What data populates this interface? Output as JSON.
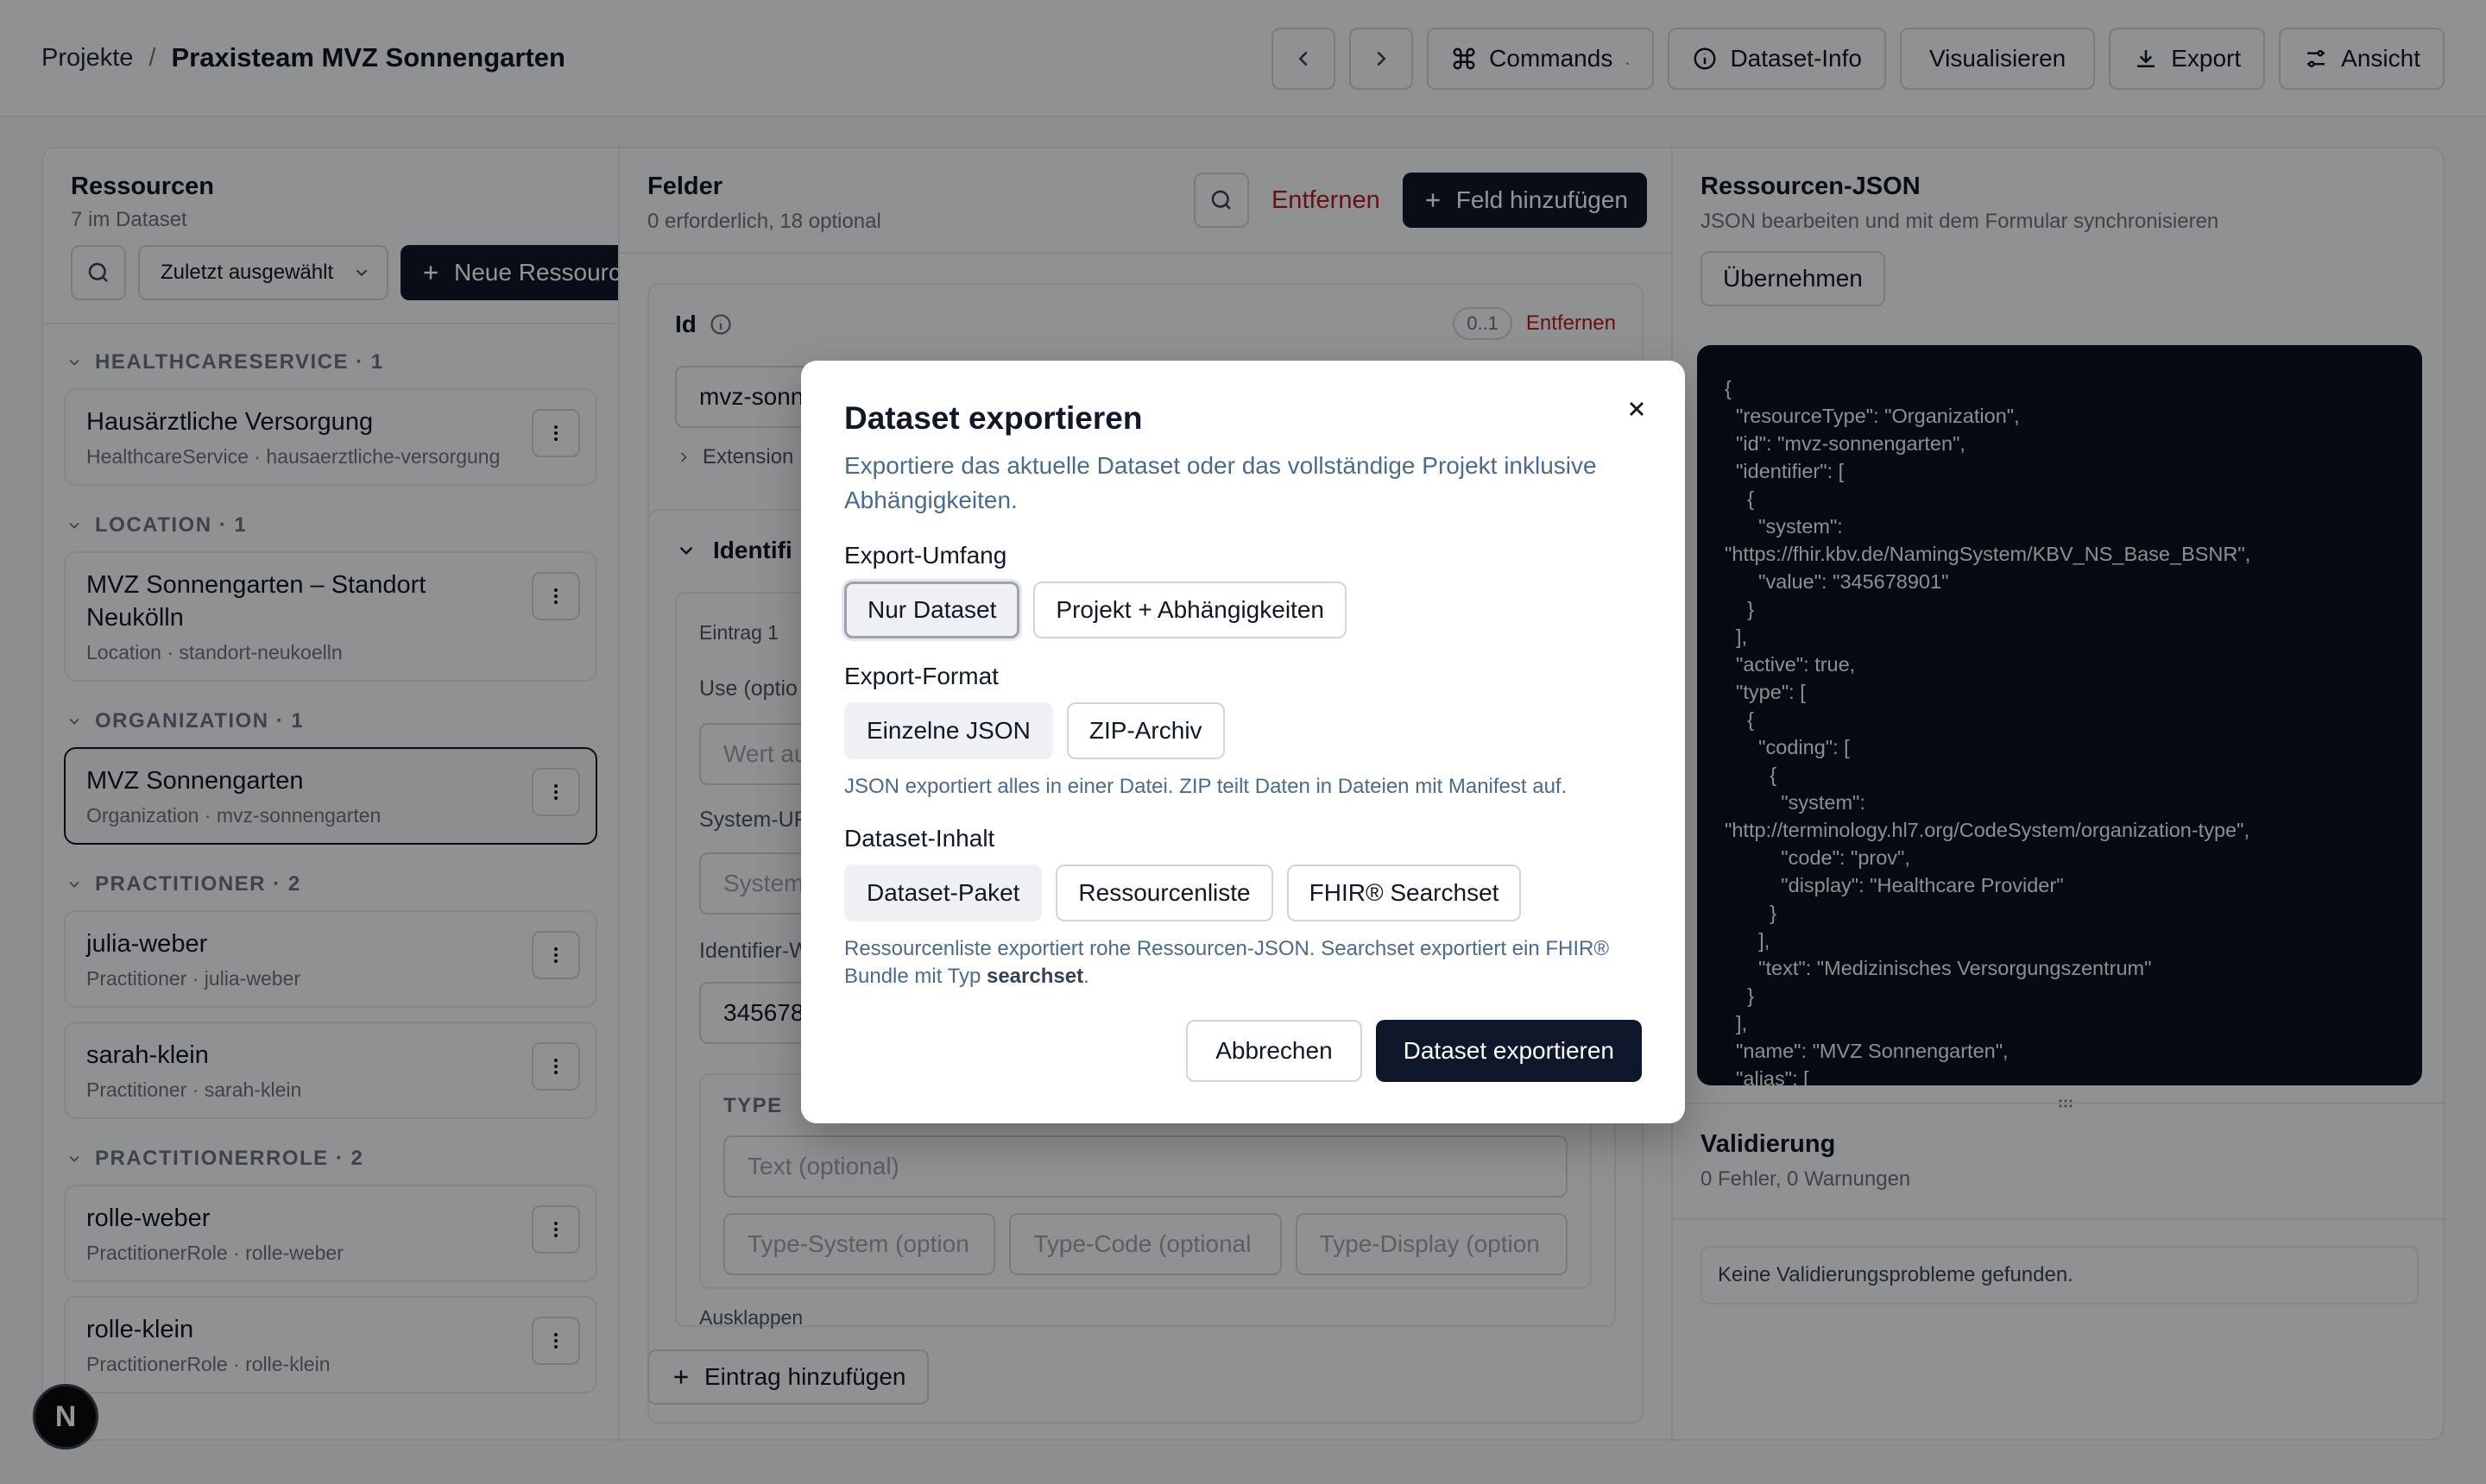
{
  "header": {
    "breadcrumb_root": "Projekte",
    "breadcrumb_sep": "/",
    "breadcrumb_current": "Praxisteam MVZ Sonnengarten",
    "buttons": {
      "commands": "Commands",
      "commands_shortcut": ".",
      "dataset_info": "Dataset-Info",
      "visualize": "Visualisieren",
      "export": "Export",
      "view": "Ansicht"
    }
  },
  "left": {
    "title": "Ressourcen",
    "subtitle": "7 im Dataset",
    "sort_select": "Zuletzt ausgewählt",
    "new_button": "Neue Ressource",
    "groups": [
      {
        "label": "HEALTHCARESERVICE · 1",
        "items": [
          {
            "title": "Hausärztliche Versorgung",
            "sub": "HealthcareService · hausaerztliche-versorgung"
          }
        ]
      },
      {
        "label": "LOCATION · 1",
        "items": [
          {
            "title": "MVZ Sonnengarten – Standort Neukölln",
            "sub": "Location · standort-neukoelln"
          }
        ]
      },
      {
        "label": "ORGANIZATION · 1",
        "items": [
          {
            "title": "MVZ Sonnengarten",
            "sub": "Organization · mvz-sonnengarten"
          }
        ]
      },
      {
        "label": "PRACTITIONER · 2",
        "items": [
          {
            "title": "julia-weber",
            "sub": "Practitioner · julia-weber"
          },
          {
            "title": "sarah-klein",
            "sub": "Practitioner · sarah-klein"
          }
        ]
      },
      {
        "label": "PRACTITIONERROLE · 2",
        "items": [
          {
            "title": "rolle-weber",
            "sub": "PractitionerRole · rolle-weber"
          },
          {
            "title": "rolle-klein",
            "sub": "PractitionerRole · rolle-klein"
          }
        ]
      }
    ]
  },
  "mid": {
    "title": "Felder",
    "subtitle": "0 erforderlich, 18 optional",
    "remove": "Entfernen",
    "add_field": "Feld hinzufügen",
    "id_label": "Id",
    "id_card_label": "0..1",
    "id_remove": "Entfernen",
    "id_value": "mvz-sonn",
    "extension": "Extension",
    "identifier_label": "Identifi",
    "entry_label": "Eintrag 1",
    "use_label": "Use (optio",
    "value_placeholder": "Wert au",
    "system_label": "System-UR",
    "system_placeholder": "System",
    "identifier_value_label": "Identifier-W",
    "identifier_value": "345678",
    "type_label": "TYPE",
    "text_placeholder": "Text (optional)",
    "type_system": "Type-System (option",
    "type_code": "Type-Code (optional",
    "type_display": "Type-Display (option",
    "collapse": "Ausklappen",
    "add_entry": "Eintrag hinzufügen"
  },
  "right": {
    "title": "Ressourcen-JSON",
    "subtitle": "JSON bearbeiten und mit dem Formular synchronisieren",
    "apply": "Übernehmen",
    "json_text": "{\n  \"resourceType\": \"Organization\",\n  \"id\": \"mvz-sonnengarten\",\n  \"identifier\": [\n    {\n      \"system\":\n\"https://fhir.kbv.de/NamingSystem/KBV_NS_Base_BSNR\",\n      \"value\": \"345678901\"\n    }\n  ],\n  \"active\": true,\n  \"type\": [\n    {\n      \"coding\": [\n        {\n          \"system\":\n\"http://terminology.hl7.org/CodeSystem/organization-type\",\n          \"code\": \"prov\",\n          \"display\": \"Healthcare Provider\"\n        }\n      ],\n      \"text\": \"Medizinisches Versorgungszentrum\"\n    }\n  ],\n  \"name\": \"MVZ Sonnengarten\",\n  \"alias\": [",
    "validation_title": "Validierung",
    "validation_sub": "0 Fehler, 0 Warnungen",
    "validation_msg": "Keine Validierungsprobleme gefunden."
  },
  "modal": {
    "title": "Dataset exportieren",
    "description": "Exportiere das aktuelle Dataset oder das vollständige Projekt inklusive Abhängigkeiten.",
    "scope_label": "Export-Umfang",
    "scope_options": [
      "Nur Dataset",
      "Projekt + Abhängigkeiten"
    ],
    "format_label": "Export-Format",
    "format_options": [
      "Einzelne JSON",
      "ZIP-Archiv"
    ],
    "format_hint": "JSON exportiert alles in einer Datei. ZIP teilt Daten in Dateien mit Manifest auf.",
    "content_label": "Dataset-Inhalt",
    "content_options": [
      "Dataset-Paket",
      "Ressourcenliste",
      "FHIR® Searchset"
    ],
    "content_hint_a": "Ressourcenliste exportiert rohe Ressourcen-JSON. Searchset exportiert ein FHIR® Bundle mit Typ ",
    "content_hint_b": "searchset",
    "content_hint_c": ".",
    "cancel": "Abbrechen",
    "confirm": "Dataset exportieren"
  },
  "badge": "N"
}
